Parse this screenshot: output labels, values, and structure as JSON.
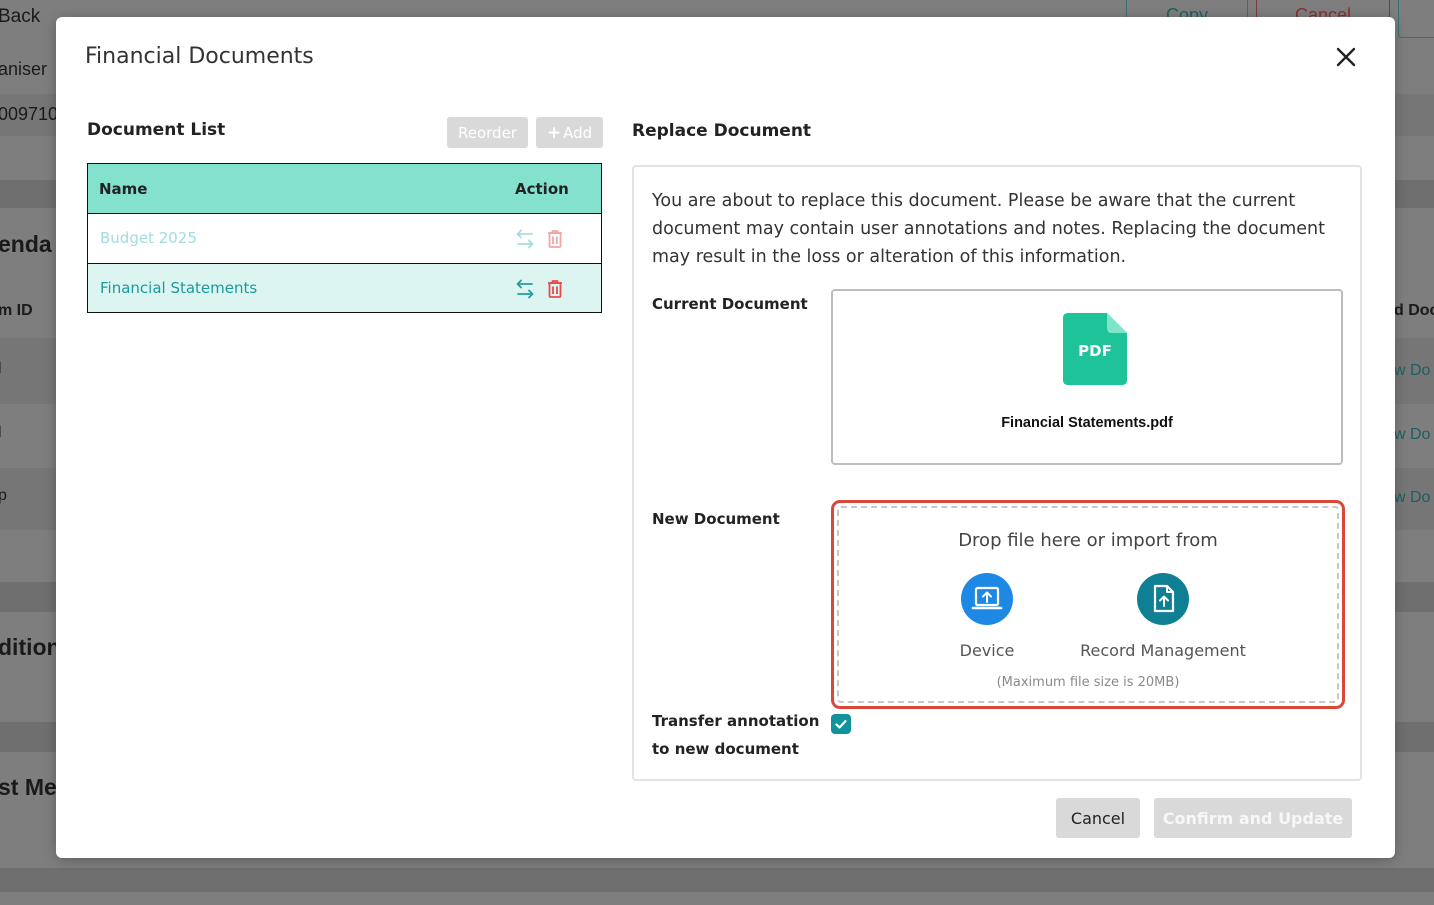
{
  "background": {
    "back_label": "Back",
    "organiser_label": "aniser",
    "number_label": "009710",
    "agenda_label": "enda",
    "item_id_label": "m ID",
    "row_markers": [
      "l",
      "l",
      "p"
    ],
    "additional_label": "dition",
    "last_meeting_label": "st Me",
    "copy_label": "Copy",
    "cancel_label": "Cancel",
    "doc_col_label": "d Doc",
    "view_doc_links": [
      "w Do",
      "w Do",
      "w Do"
    ]
  },
  "modal": {
    "title": "Financial Documents",
    "close_icon": "close-icon"
  },
  "document_list": {
    "title": "Document List",
    "reorder_label": "Reorder",
    "add_label": "Add",
    "columns": {
      "name": "Name",
      "action": "Action"
    },
    "rows": [
      {
        "name": "Budget 2025",
        "state": "disabled"
      },
      {
        "name": "Financial Statements",
        "state": "selected"
      }
    ]
  },
  "replace": {
    "title": "Replace Document",
    "warning": "You are about to replace this document. Please be aware that the current document may contain user annotations and notes. Replacing the document may result in the loss or alteration of this information.",
    "current_label": "Current Document",
    "pdf_badge": "PDF",
    "current_file": "Financial Statements.pdf",
    "new_label": "New Document",
    "drop_title": "Drop file here or import from",
    "device_label": "Device",
    "record_label": "Record Management",
    "max_size": "(Maximum file size is 20MB)",
    "transfer_label_line1": "Transfer annotation",
    "transfer_label_line2": "to new document",
    "transfer_checked": true
  },
  "footer": {
    "cancel_label": "Cancel",
    "confirm_label": "Confirm and Update"
  },
  "colors": {
    "teal_header": "#84e1cd",
    "selected_row": "#dcf5f0",
    "link_teal": "#1a9a9e",
    "pdf_green": "#1ec39a",
    "device_blue": "#1e88e5",
    "record_teal": "#0f7f93",
    "drop_border": "#d9493a"
  }
}
